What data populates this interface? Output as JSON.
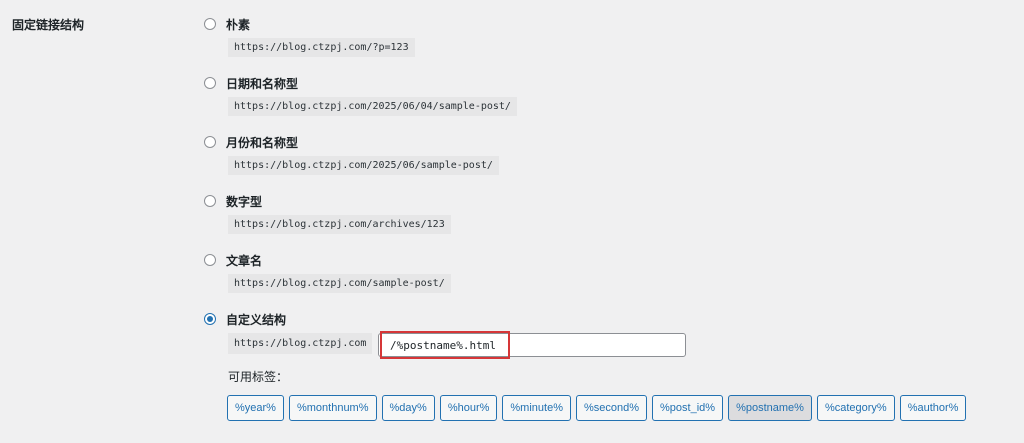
{
  "section_label": "固定链接结构",
  "options": [
    {
      "label": "朴素",
      "example": "https://blog.ctzpj.com/?p=123",
      "checked": false
    },
    {
      "label": "日期和名称型",
      "example": "https://blog.ctzpj.com/2025/06/04/sample-post/",
      "checked": false
    },
    {
      "label": "月份和名称型",
      "example": "https://blog.ctzpj.com/2025/06/sample-post/",
      "checked": false
    },
    {
      "label": "数字型",
      "example": "https://blog.ctzpj.com/archives/123",
      "checked": false
    },
    {
      "label": "文章名",
      "example": "https://blog.ctzpj.com/sample-post/",
      "checked": false
    },
    {
      "label": "自定义结构",
      "checked": true
    }
  ],
  "custom": {
    "prefix": "https://blog.ctzpj.com",
    "value": "/%postname%.html"
  },
  "tags_label": "可用标签：",
  "tags": [
    "%year%",
    "%monthnum%",
    "%day%",
    "%hour%",
    "%minute%",
    "%second%",
    "%post_id%",
    "%postname%",
    "%category%",
    "%author%"
  ],
  "active_tag": "%postname%",
  "colors": {
    "accent": "#2271b1",
    "highlight": "#d63638"
  }
}
